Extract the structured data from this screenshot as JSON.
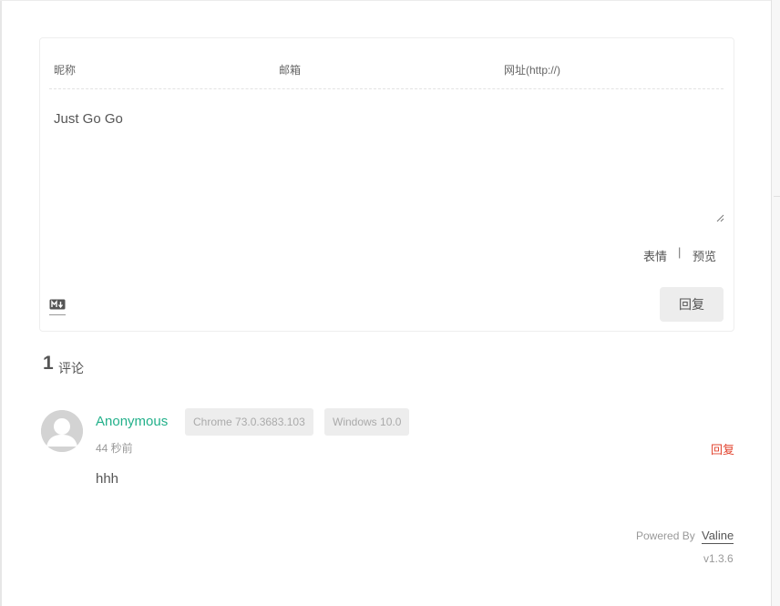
{
  "form": {
    "nick_placeholder": "昵称",
    "mail_placeholder": "邮箱",
    "link_placeholder": "网址(http://)",
    "content": "Just Go Go",
    "emoji_label": "表情",
    "separator": "|",
    "preview_label": "预览",
    "markdown_icon": "markdown-icon",
    "submit_label": "回复"
  },
  "comments_summary": {
    "count": "1",
    "label": "评论"
  },
  "comments": [
    {
      "author": "Anonymous",
      "browser": "Chrome 73.0.3683.103",
      "os": "Windows 10.0",
      "time": "44 秒前",
      "reply_label": "回复",
      "body": "hhh",
      "avatar_icon": "default-avatar-icon"
    }
  ],
  "footer": {
    "powered_by": "Powered By",
    "brand": "Valine",
    "version": "v1.3.6"
  },
  "colors": {
    "author_link": "#22b08a",
    "reply_link": "#e2442f",
    "button_bg": "#ededed"
  }
}
